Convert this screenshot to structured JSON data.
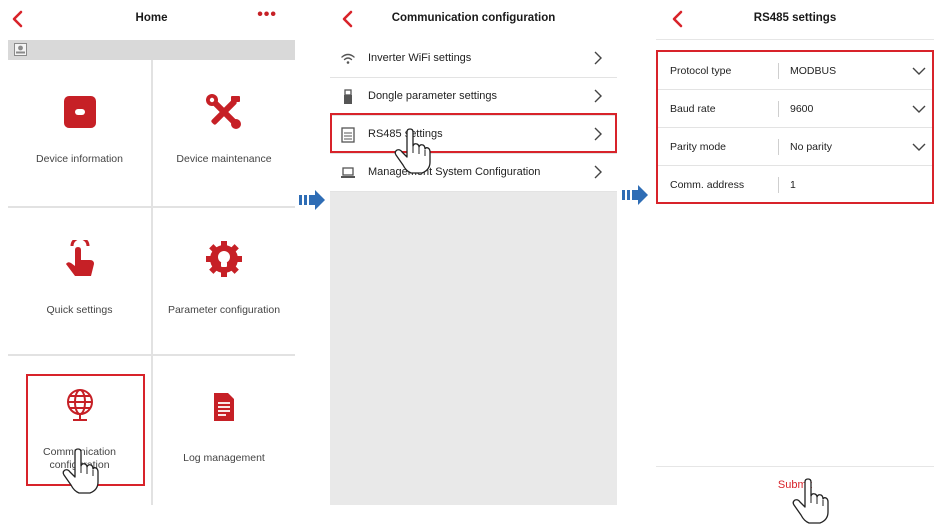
{
  "home": {
    "title": "Home",
    "more": "•••",
    "tiles": [
      {
        "label": "Device information",
        "icon": "device-info-icon"
      },
      {
        "label": "Device maintenance",
        "icon": "maintenance-tools-icon"
      },
      {
        "label": "Quick settings",
        "icon": "quick-settings-hand-icon"
      },
      {
        "label": "Parameter configuration",
        "icon": "parameter-bulb-gear-icon"
      },
      {
        "label": "Communication configuration",
        "icon": "globe-icon"
      },
      {
        "label": "Log management",
        "icon": "log-document-icon"
      }
    ]
  },
  "comm": {
    "title": "Communication configuration",
    "items": [
      {
        "label": "Inverter WiFi settings",
        "icon": "wifi-icon"
      },
      {
        "label": "Dongle parameter settings",
        "icon": "dongle-icon"
      },
      {
        "label": "RS485 settings",
        "icon": "rs485-icon"
      },
      {
        "label": "Management System Configuration",
        "icon": "laptop-icon"
      }
    ]
  },
  "rs485": {
    "title": "RS485 settings",
    "fields": [
      {
        "label": "Protocol type",
        "value": "MODBUS",
        "dropdown": true
      },
      {
        "label": "Baud rate",
        "value": "9600",
        "dropdown": true
      },
      {
        "label": "Parity mode",
        "value": "No parity",
        "dropdown": true
      },
      {
        "label": "Comm. address",
        "value": "1",
        "dropdown": false
      }
    ],
    "submit": "Submit"
  },
  "colors": {
    "accent": "#d8232a",
    "tile_red": "#c62026",
    "arrow_blue": "#2f6db5",
    "divider": "#e2e2e2"
  }
}
